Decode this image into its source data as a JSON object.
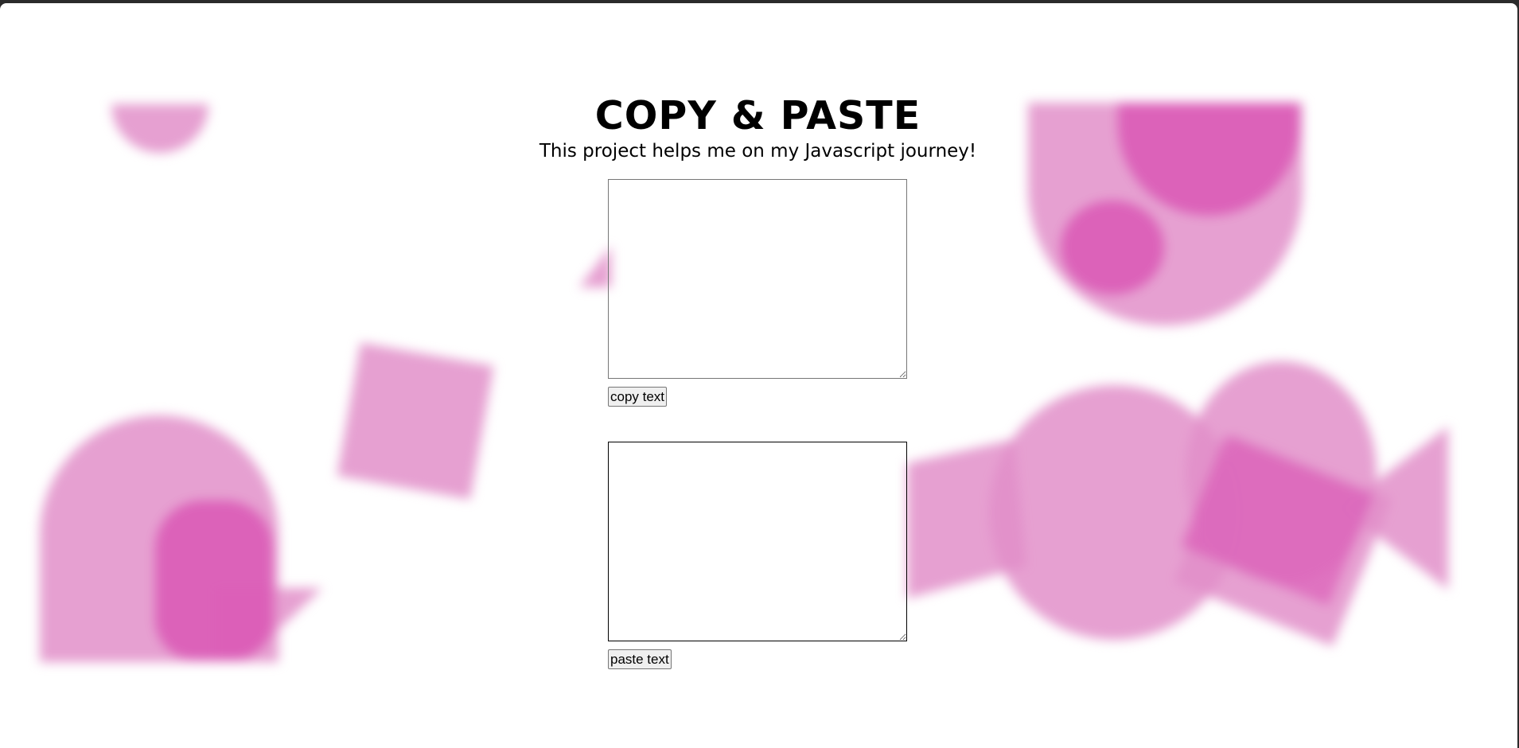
{
  "page": {
    "title": "COPY & PASTE",
    "subtitle": "This project helps me on my Javascript journey!"
  },
  "copy_section": {
    "textarea_value": "",
    "button_label": "copy text"
  },
  "paste_section": {
    "textarea_value": "",
    "button_label": "paste text"
  },
  "colors": {
    "shape_light": "#e28fc9",
    "shape_deep": "#d94fb2",
    "page_background": "#ffffff",
    "window_chrome": "#2b2b2b"
  }
}
